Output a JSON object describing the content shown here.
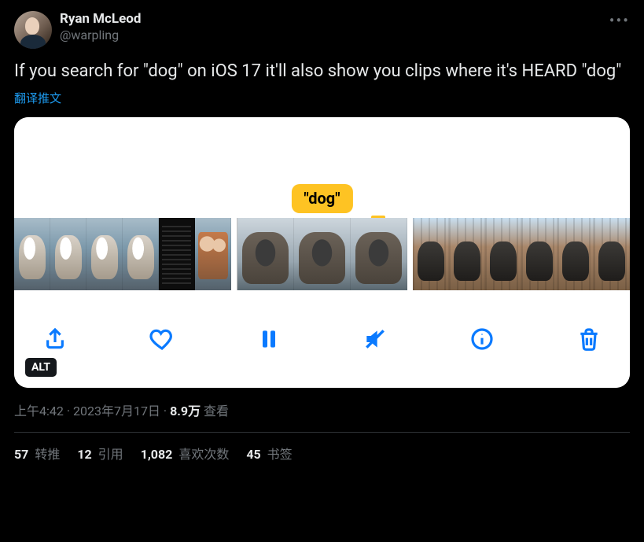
{
  "author": {
    "display_name": "Ryan McLeod",
    "handle": "@warpling"
  },
  "tweet_text": "If you search for \"dog\" on iOS 17 it'll also show you clips where it's HEARD \"dog\"",
  "translate_label": "翻译推文",
  "media": {
    "search_term": "\"dog\"",
    "alt_badge": "ALT"
  },
  "meta": {
    "time": "上午4:42",
    "dot": " · ",
    "date": "2023年7月17日",
    "views_count": "8.9万",
    "views_label": " 查看"
  },
  "stats": {
    "retweets": {
      "count": "57",
      "label": " 转推"
    },
    "quotes": {
      "count": "12",
      "label": " 引用"
    },
    "likes": {
      "count": "1,082",
      "label": " 喜欢次数"
    },
    "bookmarks": {
      "count": "45",
      "label": " 书签"
    }
  }
}
